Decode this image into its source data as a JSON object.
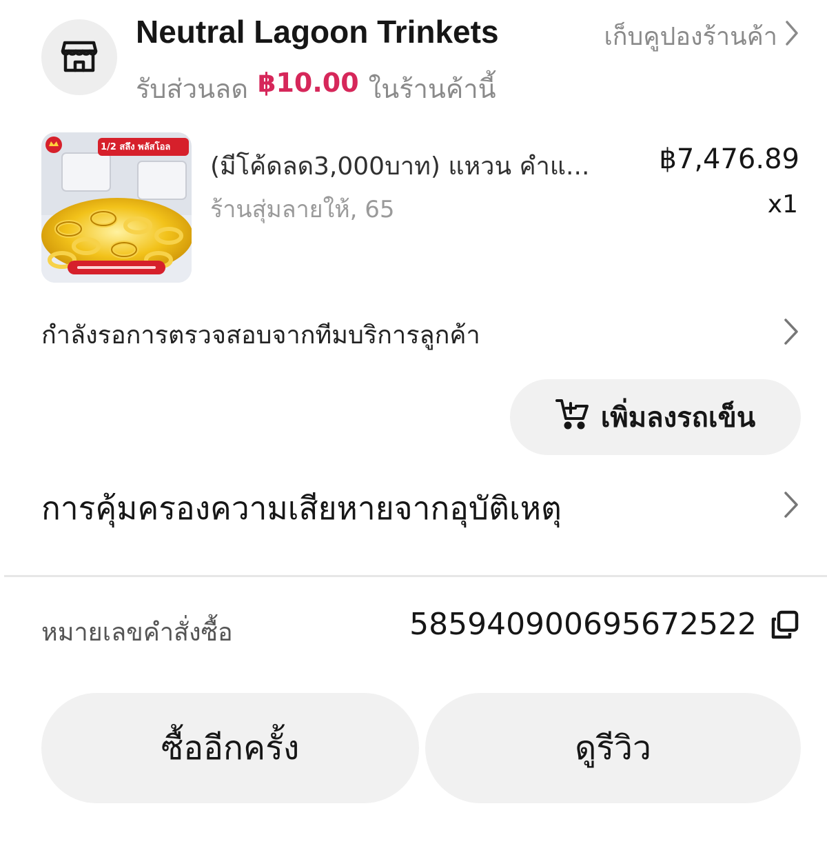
{
  "shop": {
    "name": "Neutral Lagoon Trinkets",
    "coupon_label": "เก็บคูปองร้านค้า",
    "discount_prefix": "รับส่วนลด",
    "discount_amount": "฿10.00",
    "discount_suffix": "ในร้านค้านี้"
  },
  "product": {
    "badge_text": "1/2 สลึง พลัสโอล",
    "title": "(มีโค้ดลด3,000บาท) แหวน คำแ...",
    "variant": "ร้านสุ่มลายให้, 65",
    "price": "฿7,476.89",
    "quantity": "x1"
  },
  "review_status": {
    "label": "กำลังรอการตรวจสอบจากทีมบริการลูกค้า"
  },
  "add_to_cart": {
    "label": "เพิ่มลงรถเข็น"
  },
  "protection": {
    "label": "การคุ้มครองความเสียหายจากอุบัติเหตุ"
  },
  "order": {
    "label": "หมายเลขคำสั่งซื้อ",
    "number": "585940900695672522"
  },
  "actions": {
    "buy_again": "ซื้ออีกครั้ง",
    "view_review": "ดูรีวิว"
  },
  "colors": {
    "accent": "#d6275a",
    "button_bg": "#f1f1f1",
    "muted_text": "#8a8a8a"
  },
  "icons": {
    "shop": "store-icon",
    "chevron": "chevron-right-icon",
    "cart": "cart-plus-icon",
    "copy": "copy-icon"
  }
}
